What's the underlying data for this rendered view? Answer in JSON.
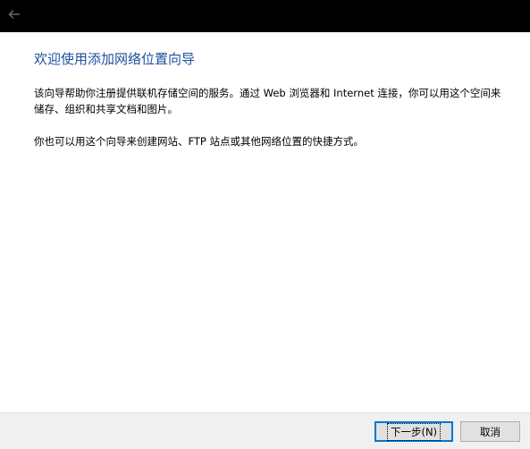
{
  "titlebar": {
    "back_icon": "back-arrow-icon"
  },
  "main": {
    "title": "欢迎使用添加网络位置向导",
    "paragraph_1": "该向导帮助你注册提供联机存储空间的服务。通过 Web 浏览器和 Internet 连接，你可以用这个空间来储存、组织和共享文档和图片。",
    "paragraph_2": "你也可以用这个向导来创建网站、FTP 站点或其他网络位置的快捷方式。"
  },
  "footer": {
    "next_label": "下一步(N)",
    "cancel_label": "取消"
  },
  "colors": {
    "title": "#1f4e9c",
    "titlebar": "#000000",
    "footer": "#f0f0f0",
    "focus_border": "#0078d7"
  }
}
